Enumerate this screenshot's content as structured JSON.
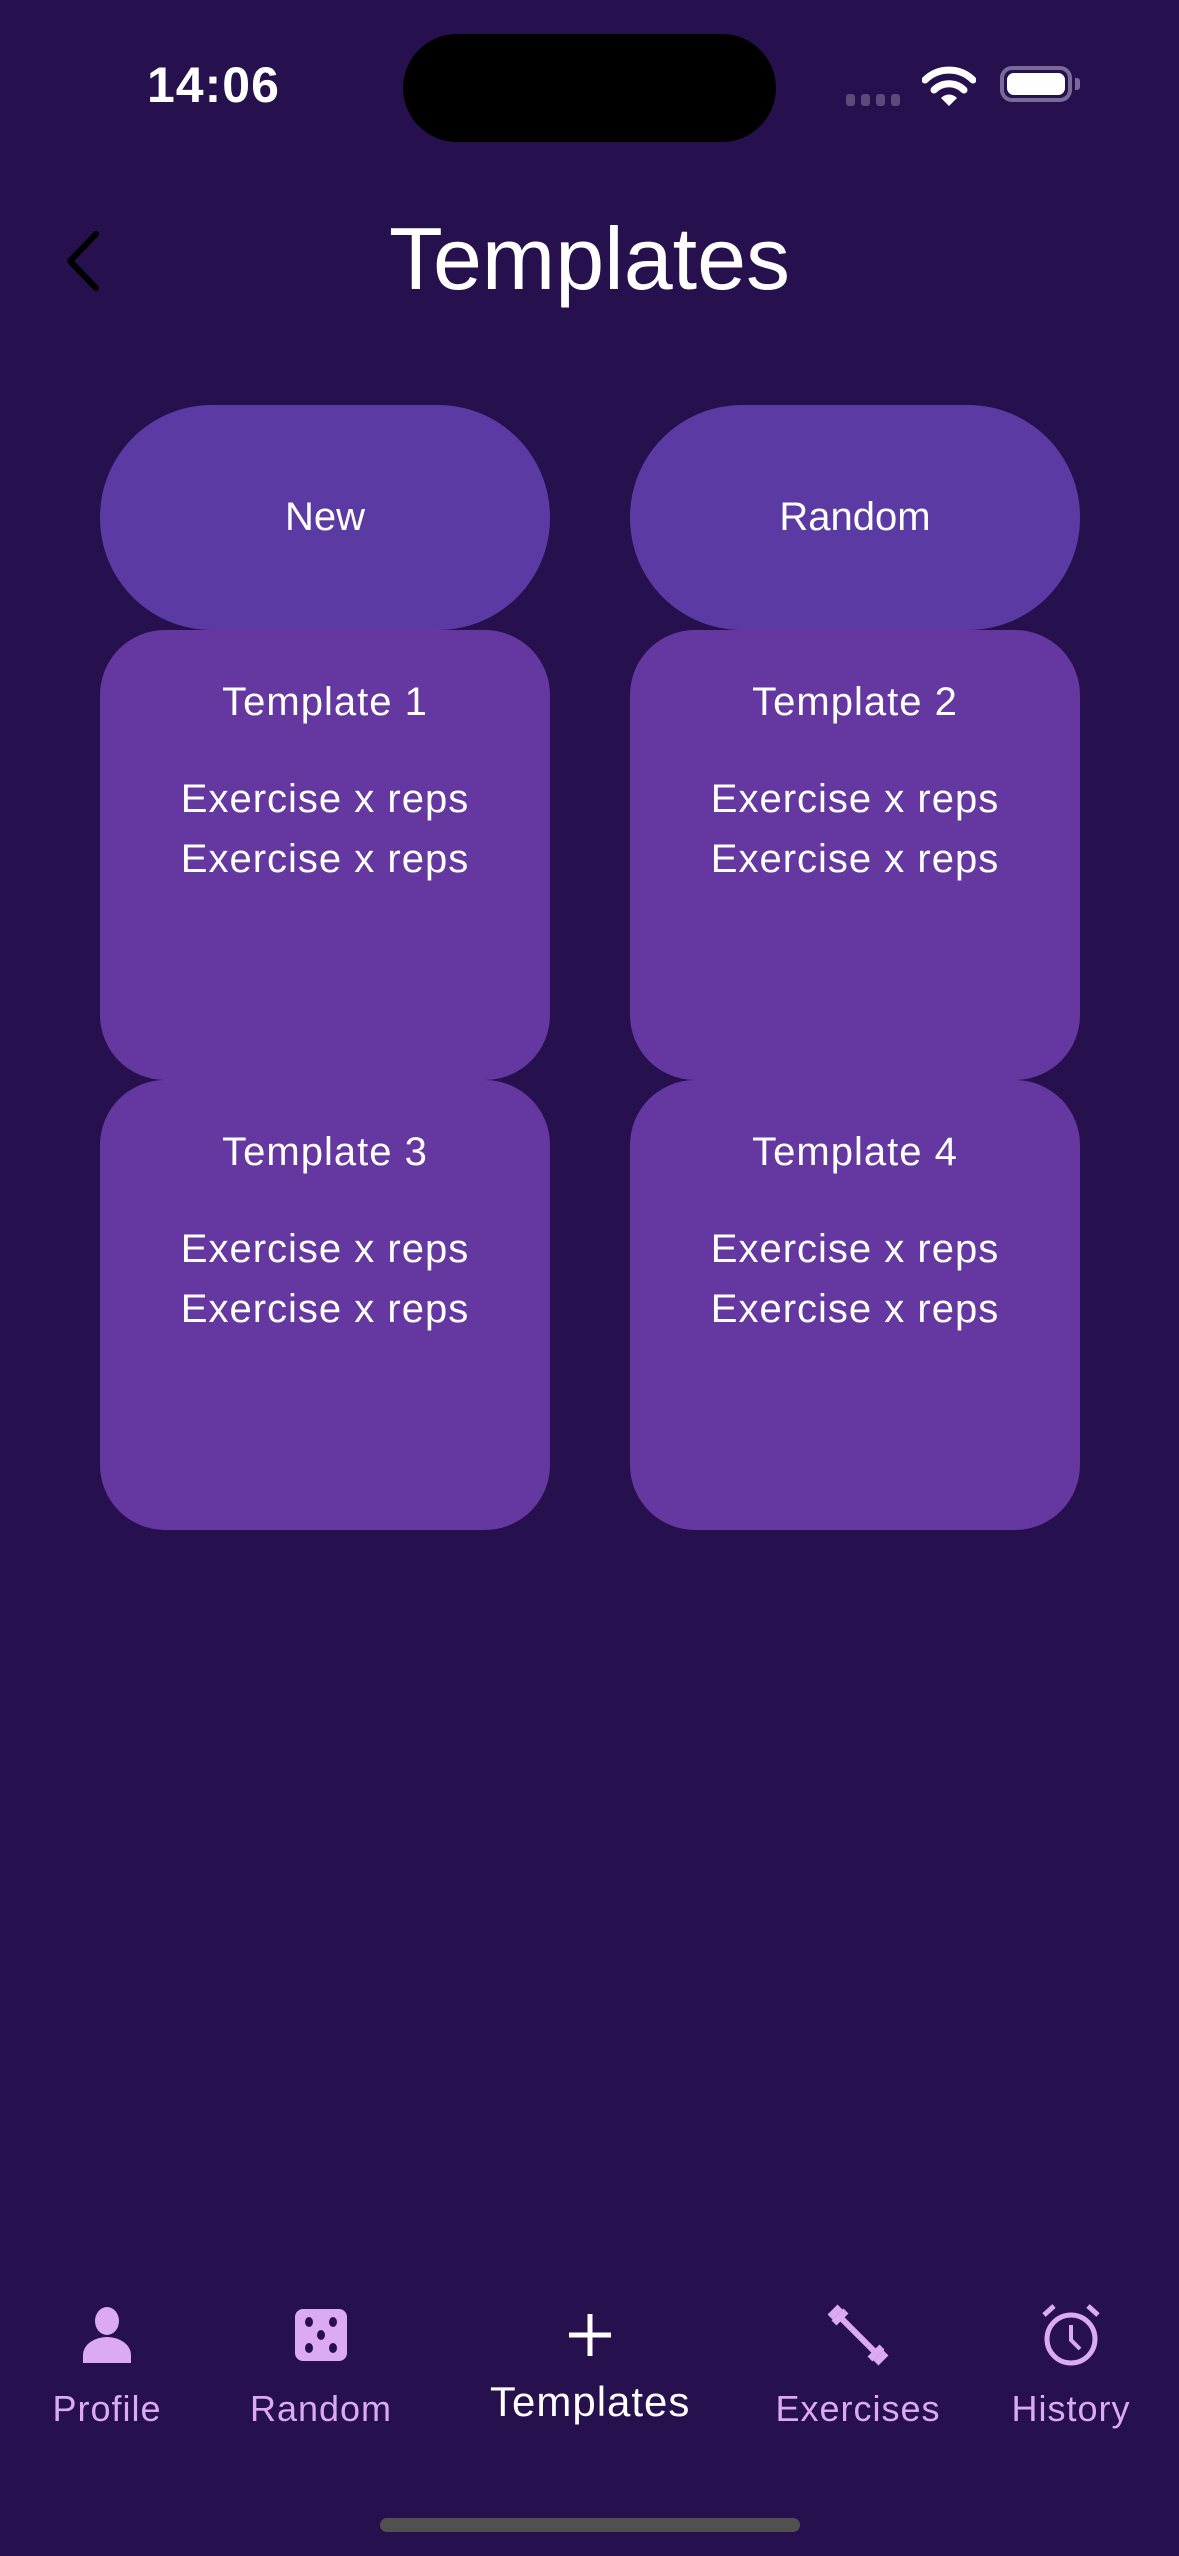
{
  "status_bar": {
    "time": "14:06"
  },
  "header": {
    "title": "Templates",
    "back_icon": "chevron-left-icon"
  },
  "actions": [
    {
      "label": "New"
    },
    {
      "label": "Random"
    }
  ],
  "templates": [
    {
      "title": "Template 1",
      "exercises": [
        "Exercise x reps",
        "Exercise x reps"
      ]
    },
    {
      "title": "Template 2",
      "exercises": [
        "Exercise x reps",
        "Exercise x reps"
      ]
    },
    {
      "title": "Template 3",
      "exercises": [
        "Exercise x reps",
        "Exercise x reps"
      ]
    },
    {
      "title": "Template 4",
      "exercises": [
        "Exercise x reps",
        "Exercise x reps"
      ]
    }
  ],
  "tab_bar": {
    "active": "Templates",
    "items": [
      {
        "label": "Profile",
        "icon": "person-icon"
      },
      {
        "label": "Random",
        "icon": "dice-icon"
      },
      {
        "label": "Templates",
        "icon": "plus-icon"
      },
      {
        "label": "Exercises",
        "icon": "dumbbell-icon"
      },
      {
        "label": "History",
        "icon": "alarm-clock-icon"
      }
    ]
  },
  "colors": {
    "background": "#26104e",
    "button": "#5c3aa3",
    "card": "#6438a0",
    "tab_inactive": "#dcaaf0",
    "tab_active": "#ffffff"
  }
}
